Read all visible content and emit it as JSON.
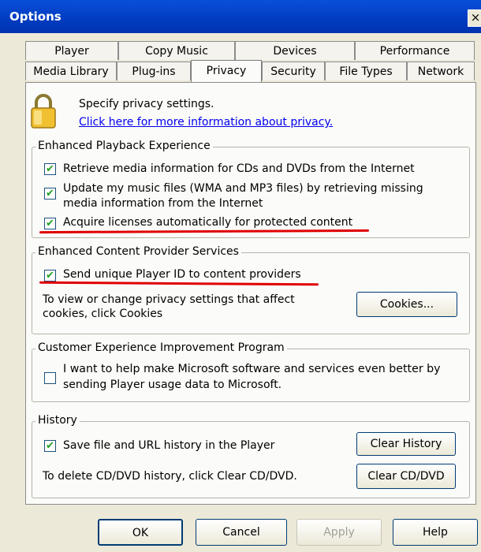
{
  "window": {
    "title": "Options",
    "close": "×"
  },
  "tabs": {
    "row1": [
      "Player",
      "Copy Music",
      "Devices",
      "Performance"
    ],
    "row2": [
      "Media Library",
      "Plug-ins",
      "Privacy",
      "Security",
      "File Types",
      "Network"
    ],
    "active": "Privacy"
  },
  "header": {
    "text": "Specify privacy settings.",
    "link": "Click here for more information about privacy."
  },
  "playback": {
    "legend": "Enhanced Playback Experience",
    "item1": "Retrieve media information for CDs and DVDs from the Internet",
    "item2_line1": "Update my music files (WMA and MP3 files) by retrieving missing",
    "item2_line2": "media information from the Internet",
    "item3": "Acquire licenses automatically for protected content"
  },
  "provider": {
    "legend": "Enhanced Content Provider Services",
    "item1": "Send unique Player ID to content providers",
    "desc_line1": "To view or change privacy settings that affect",
    "desc_line2": "cookies, click Cookies",
    "cookies_button": "Cookies..."
  },
  "ceip": {
    "legend": "Customer Experience Improvement Program",
    "item_line1": "I want to help make Microsoft software and services even better by",
    "item_line2": "sending Player usage data to Microsoft."
  },
  "history": {
    "legend": "History",
    "item1": "Save file and URL history in the Player",
    "clear_history_button": "Clear History",
    "desc": "To delete  CD/DVD history, click Clear CD/DVD.",
    "clear_cd_button": "Clear CD/DVD"
  },
  "footer": {
    "ok": "OK",
    "cancel": "Cancel",
    "apply": "Apply",
    "help": "Help"
  },
  "checkbox_mark": "✔",
  "colors": {
    "titlebar": "#0a4fd8",
    "highlight": "#e00000",
    "link": "#0000ee",
    "check": "#21a121"
  }
}
